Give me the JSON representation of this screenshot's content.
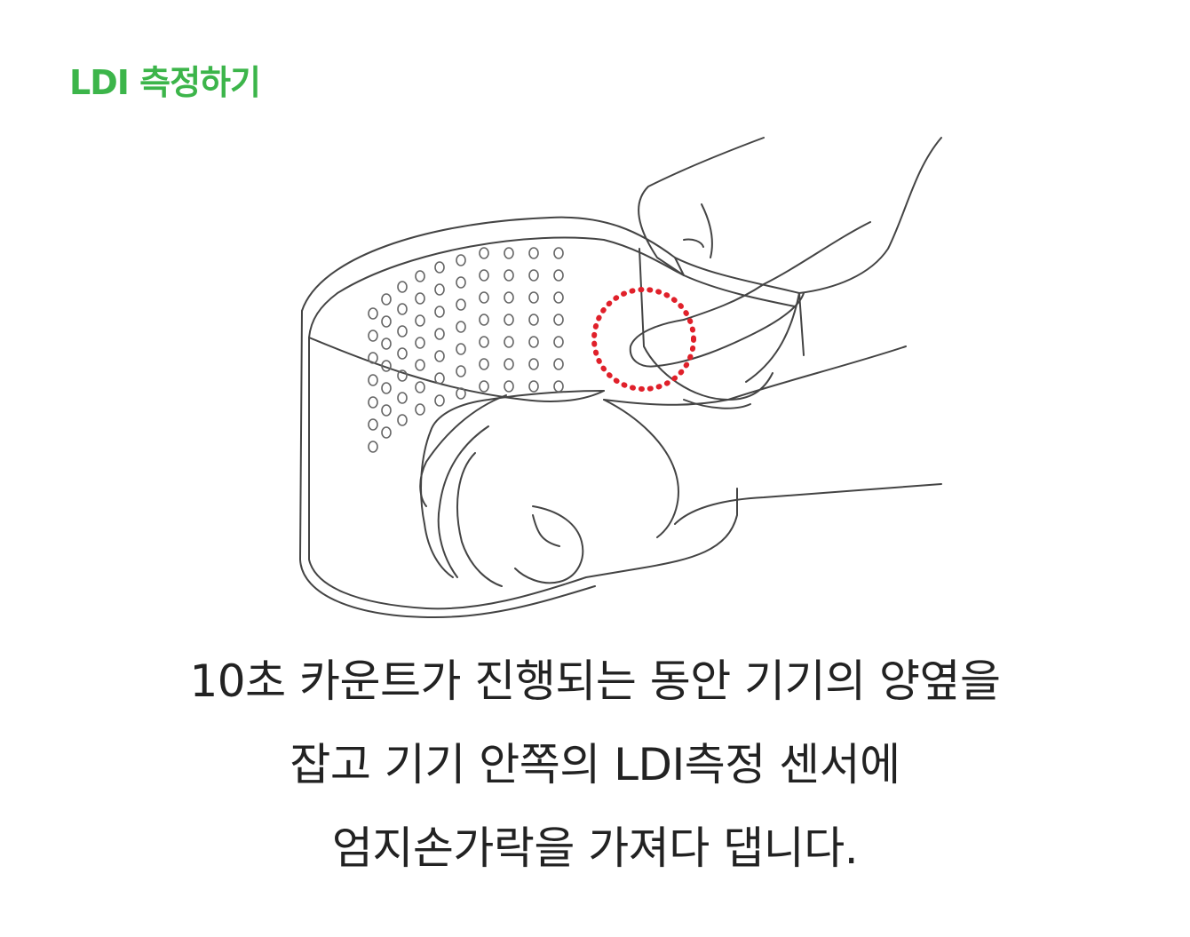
{
  "title": "LDI 측정하기",
  "illustration": {
    "icon": "hand-holding-device-illustration",
    "sensor_marker_color": "#e0202a",
    "line_color": "#333333"
  },
  "instruction": {
    "lines": [
      "10초 카운트가 진행되는 동안 기기의 양옆을",
      "잡고 기기 안쪽의 LDI측정 센서에",
      "엄지손가락을 가져다 댑니다."
    ]
  },
  "colors": {
    "title": "#3cb54a",
    "text": "#222222"
  }
}
